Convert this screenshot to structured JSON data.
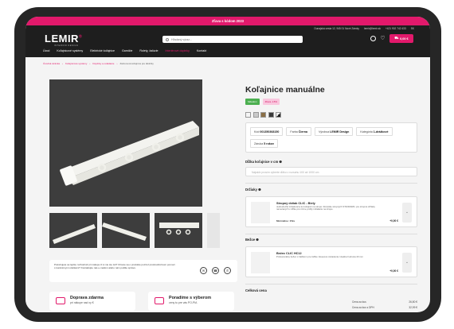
{
  "promo_bar": "Zľava s kódom 2023",
  "top_info": [
    "Dunajská cesta 12, 945 01 Nové Zámky",
    "lemir@lemir.sk",
    "+421 902 742 433",
    "SK"
  ],
  "brand": {
    "name": "LEMIR",
    "mark": "®",
    "tagline": "INTERIOR DESIGN"
  },
  "search": {
    "placeholder": "Hľadaný výraz..."
  },
  "cart": {
    "label": "0,00 €"
  },
  "nav": [
    "Úvod",
    "Koľajnicové systémy",
    "Elektrické koľajnice",
    "Garnižie",
    "Rolety, žalúzie",
    "Interiérové doplnky",
    "Kontakt"
  ],
  "breadcrumbs": [
    "Úvodná stránka",
    "Koľajnicové systémy",
    "Doplnky a ovládanie",
    "Záclonová koľajnica pre láktičky"
  ],
  "product": {
    "title": "Koľajnice manuálne",
    "stock_badge": "Skladom",
    "promo_badge": "Zľava -15%",
    "swatch_colors": [
      "#f5f5f5",
      "#c9c9c9",
      "#8b6f47",
      "#3a3a3a",
      "#f0f0f0"
    ],
    "specs": [
      {
        "k": "Kód",
        "v": "001350368150"
      },
      {
        "k": "Farba",
        "v": "Čierna"
      },
      {
        "k": "Výrobca",
        "v": "LEMIR Design"
      },
      {
        "k": "Kategória",
        "v": "1-drážkové"
      },
      {
        "k": "Záruka",
        "v": "5 rokov"
      }
    ],
    "length_label": "Dĺžka koľajnice v cm",
    "length_placeholder": "Najskôr prosím vyberte dĺžku v rozsahu 100 až 1000 cm",
    "holders_label": "Držiaky",
    "holder": {
      "title": "Stropný držiak CLIC - Biely",
      "desc": "Jednoduché inštalovaný ku koľajnici na stropé. Rozpätie stropných STANDARD, pre stropné držiaky nameraných v dĺžke pre rôzne profily inštalácie na strope.",
      "min": "Minimálne: 15ks",
      "price": "+0,00 €"
    },
    "runners_label": "Bežce",
    "runner": {
      "title": "Bežec CLIC HC12",
      "desc": "Profesionálny bežec s háčikom pre ťažšie závesové zariadenia. Ideálna hodnota 40 mm",
      "price": "+0,00 €"
    },
    "total_label": "Celková cena",
    "totals": [
      {
        "k": "Cena za kus",
        "v": "26,80 €"
      },
      {
        "k": "Cena za kus s DPH",
        "v": "32,99 €"
      }
    ]
  },
  "help_note": {
    "text": "Potrebujete sa lepšie rozhodnúť pri nákupe či si nie ste istí? Chcete sa o produkte pozrieť prostredníctvom pomoci s konkrétnymi otázkami? Kontaktujte nás e-mailom alebo nám pošlite správu.",
    "icons": [
      "email",
      "phone",
      "whatsapp"
    ]
  },
  "features": [
    {
      "title": "Doprava zdarma",
      "sub": "pri nákupe nad xy €"
    },
    {
      "title": "Poradíme s výberom",
      "sub": "ceny tu pre vás PO-PIA"
    }
  ],
  "colors": {
    "accent": "#e2196b",
    "header": "#1e1e1e",
    "bezel": "#262626",
    "gallery_bg": "#3d3d3d"
  }
}
